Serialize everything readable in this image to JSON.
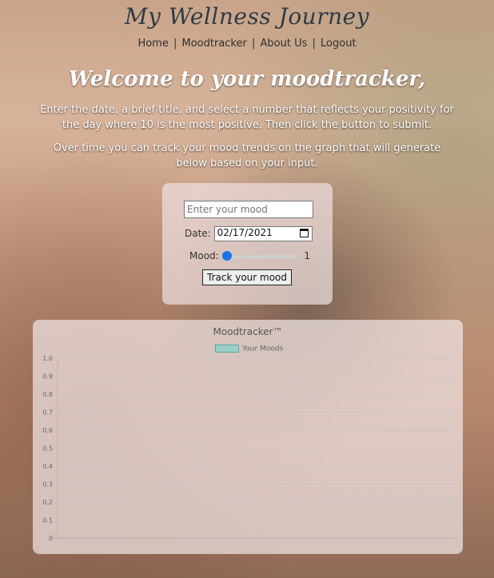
{
  "header": {
    "brand": "My Wellness Journey",
    "nav": [
      {
        "label": "Home"
      },
      {
        "label": "Moodtracker"
      },
      {
        "label": "About Us"
      },
      {
        "label": "Logout"
      }
    ],
    "separator": "|"
  },
  "hero": {
    "title": "Welcome to your moodtracker,",
    "paragraph1": "Enter the date, a brief title, and select a number that reflects your positivity for the day where 10 is the most positive. Then click the button to submit.",
    "paragraph2": "Over time you can track your mood trends on the graph that will generate below based on your input."
  },
  "form": {
    "mood_placeholder": "Enter your mood",
    "date_label": "Date:",
    "date_value": "02/17/2021",
    "mood_label": "Mood:",
    "mood_value": "1",
    "submit_label": "Track your mood",
    "slider_min": 1,
    "slider_max": 10
  },
  "chart_data": {
    "type": "line",
    "title": "Moodtracker™",
    "series": [
      {
        "name": "Your Moods",
        "values": []
      }
    ],
    "y_ticks": [
      "0",
      "0.1",
      "0.2",
      "0.3",
      "0.4",
      "0.5",
      "0.6",
      "0.7",
      "0.8",
      "0.9",
      "1.0"
    ],
    "ylim": [
      0,
      1
    ],
    "grid": true,
    "legend": "top",
    "colors": {
      "series_fill": "#9dcfc6",
      "series_border": "#58a89a"
    }
  }
}
